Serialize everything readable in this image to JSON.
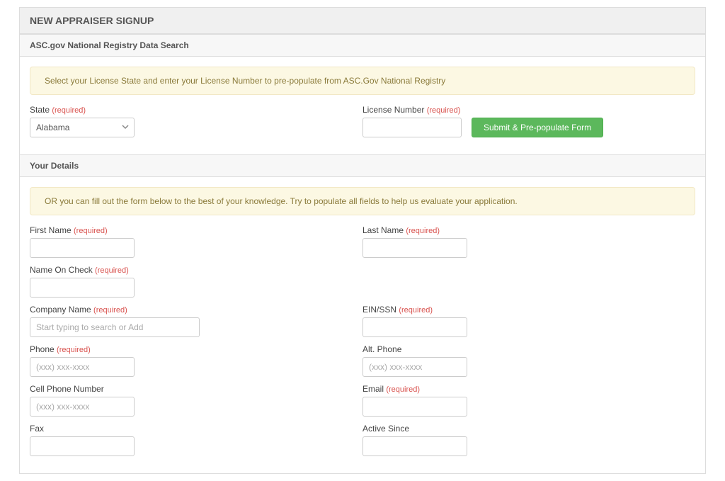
{
  "page": {
    "title": "NEW APPRAISER SIGNUP"
  },
  "search_section": {
    "header": "ASC.gov National Registry Data Search",
    "alert": "Select your License State and enter your License Number to pre-populate from ASC.Gov National Registry",
    "state": {
      "label": "State ",
      "required": "(required)",
      "value": "Alabama"
    },
    "license_number": {
      "label": "License Number ",
      "required": "(required)",
      "value": ""
    },
    "submit_label": "Submit & Pre-populate Form"
  },
  "details_section": {
    "header": "Your Details",
    "alert": "OR you can fill out the form below to the best of your knowledge. Try to populate all fields to help us evaluate your application.",
    "first_name": {
      "label": "First Name ",
      "required": "(required)",
      "value": ""
    },
    "last_name": {
      "label": "Last Name ",
      "required": "(required)",
      "value": ""
    },
    "name_on_check": {
      "label": "Name On Check ",
      "required": "(required)",
      "value": ""
    },
    "company": {
      "label": "Company Name ",
      "required": "(required)",
      "placeholder": "Start typing to search or Add",
      "value": ""
    },
    "ein_ssn": {
      "label": "EIN/SSN ",
      "required": "(required)",
      "value": ""
    },
    "phone": {
      "label": "Phone ",
      "required": "(required)",
      "placeholder": "(xxx) xxx-xxxx",
      "value": ""
    },
    "alt_phone": {
      "label": "Alt. Phone",
      "placeholder": "(xxx) xxx-xxxx",
      "value": ""
    },
    "cell_phone": {
      "label": "Cell Phone Number",
      "placeholder": "(xxx) xxx-xxxx",
      "value": ""
    },
    "email": {
      "label": "Email ",
      "required": "(required)",
      "value": ""
    },
    "fax": {
      "label": "Fax",
      "value": ""
    },
    "active_since": {
      "label": "Active Since",
      "value": ""
    }
  }
}
